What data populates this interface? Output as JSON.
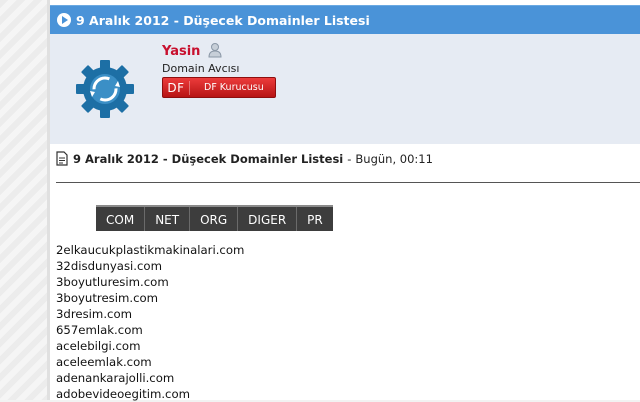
{
  "thread": {
    "title": "9 Aralık 2012 - Düşecek Domainler Listesi"
  },
  "user": {
    "name": "Yasin",
    "title": "Domain Avcısı",
    "rank_abbr": "DF",
    "rank_label": "DF Kurucusu"
  },
  "post": {
    "title": "9 Aralık 2012 - Düşecek Domainler Listesi",
    "separator": "-",
    "date": "Bugün, 00:11"
  },
  "tabs": [
    "COM",
    "NET",
    "ORG",
    "DIGER",
    "PR"
  ],
  "domains": [
    "2elkaucukplastikmakinalari.com",
    "32disdunyasi.com",
    "3boyutluresim.com",
    "3boyutresim.com",
    "3dresim.com",
    "657emlak.com",
    "acelebilgi.com",
    "aceleemlak.com",
    "adenankarajolli.com",
    "adobevideoegitim.com"
  ],
  "colors": {
    "titlebar": "#4a93d8",
    "username": "#c8102e",
    "rank_badge": "#d62222",
    "tabs_bg": "#3d3d3d"
  }
}
